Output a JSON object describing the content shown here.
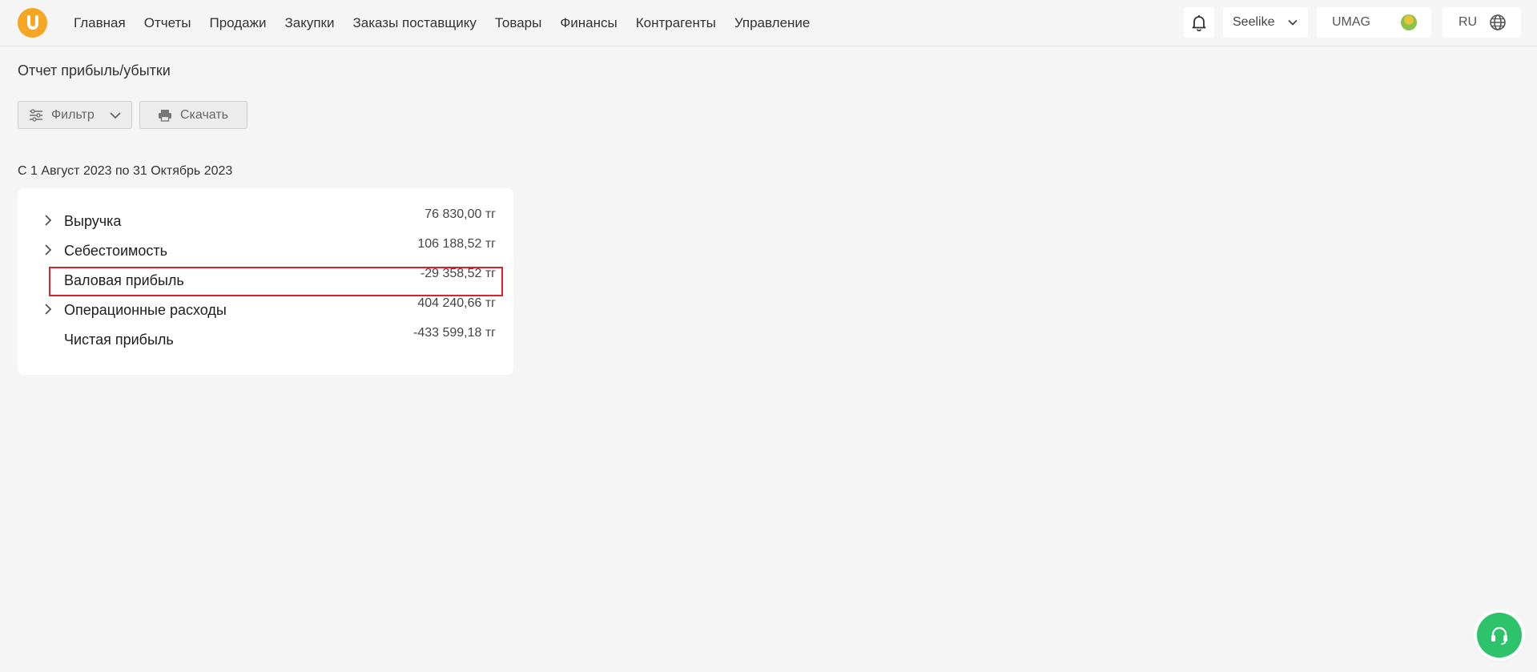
{
  "nav": {
    "items": [
      "Главная",
      "Отчеты",
      "Продажи",
      "Закупки",
      "Заказы поставщику",
      "Товары",
      "Финансы",
      "Контрагенты",
      "Управление"
    ]
  },
  "header": {
    "store": "Seelike",
    "account": "UMAG",
    "language": "RU"
  },
  "page": {
    "title": "Отчет прибыль/убытки",
    "filter_label": "Фильтр",
    "download_label": "Скачать",
    "period": "С 1 Август 2023 по 31 Октябрь 2023"
  },
  "report": {
    "rows": [
      {
        "label": "Выручка",
        "value": "76 830,00 тг",
        "expandable": true
      },
      {
        "label": "Себестоимость",
        "value": "106 188,52 тг",
        "expandable": true
      },
      {
        "label": "Валовая прибыль",
        "value": "-29 358,52 тг",
        "expandable": false
      },
      {
        "label": "Операционные расходы",
        "value": "404 240,66 тг",
        "expandable": true
      },
      {
        "label": "Чистая прибыль",
        "value": "-433 599,18 тг",
        "expandable": false
      }
    ]
  },
  "colors": {
    "accent": "#f5a623",
    "highlight": "#d8232a",
    "support": "#2cc36b"
  },
  "icons": [
    "logo-icon",
    "bell-icon",
    "chevron-down-icon",
    "avatar-icon",
    "globe-icon",
    "filter-icon",
    "printer-icon",
    "chevron-right-icon",
    "headset-icon"
  ]
}
